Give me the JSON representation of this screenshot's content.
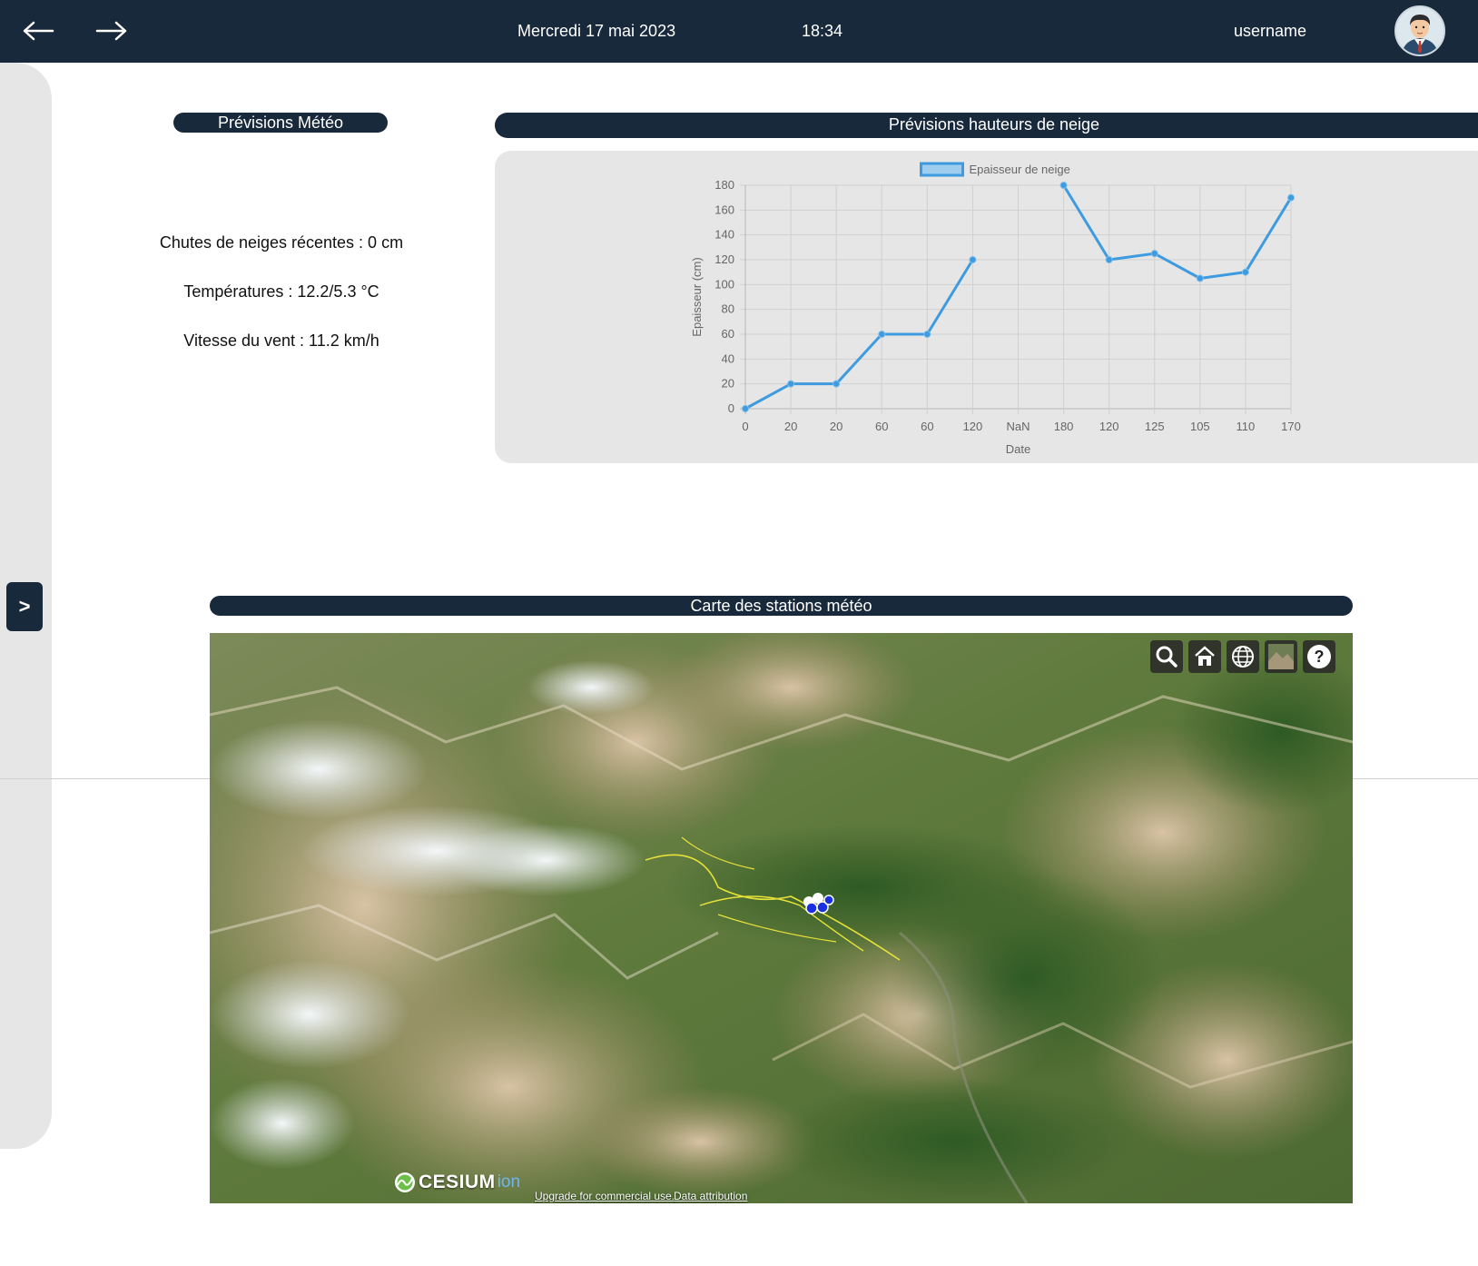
{
  "header": {
    "back_icon": "arrow-left-icon",
    "forward_icon": "arrow-right-icon",
    "date": "Mercredi 17 mai 2023",
    "time": "18:34",
    "username": "username",
    "avatar_icon": "user-avatar-icon",
    "background": "#18293b"
  },
  "sidebar": {
    "toggle_label": ">"
  },
  "weather": {
    "title": "Prévisions Météo",
    "snowfall": "Chutes de neiges récentes : 0 cm",
    "temperatures": "Températures : 12.2/5.3 °C",
    "wind": "Vitesse du vent : 11.2 km/h"
  },
  "snow_section": {
    "title": "Prévisions hauteurs de neige"
  },
  "chart_data": {
    "type": "line",
    "categories": [
      "0",
      "20",
      "20",
      "60",
      "60",
      "120",
      "NaN",
      "180",
      "120",
      "125",
      "105",
      "110",
      "170"
    ],
    "series": [
      {
        "name": "Epaisseur de neige",
        "values": [
          0,
          20,
          20,
          60,
          60,
          120,
          null,
          180,
          120,
          125,
          105,
          110,
          170
        ],
        "color": "#3e9be0"
      }
    ],
    "xlabel": "Date",
    "ylabel": "Epaisseur (cm)",
    "ylim": [
      0,
      180
    ],
    "yticks": [
      0,
      20,
      40,
      60,
      80,
      100,
      120,
      140,
      160,
      180
    ],
    "grid": true,
    "legend": "top"
  },
  "map_section": {
    "title": "Carte des stations météo",
    "toolbar": [
      "search-icon",
      "home-icon",
      "globe-icon",
      "imagery-layer-icon",
      "help-icon"
    ],
    "logo_text": "CESIUM",
    "logo_suffix": "ion",
    "credit_upgrade": "Upgrade for commercial use.",
    "credit_attribution": "Data attribution"
  },
  "colors": {
    "accent": "#18293b",
    "panel": "#e6e6e6",
    "series": "#3e9be0"
  }
}
